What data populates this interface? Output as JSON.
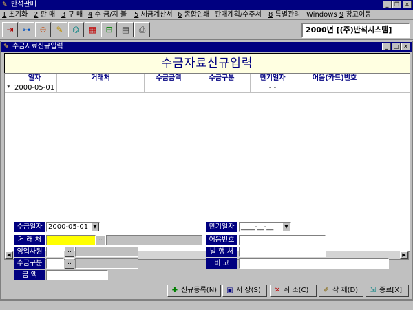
{
  "app": {
    "title": "반석판매",
    "window_buttons": [
      "_",
      "❐",
      "✕"
    ]
  },
  "menu": [
    {
      "key": "1",
      "label": "초기화"
    },
    {
      "key": "2",
      "label": "판 매"
    },
    {
      "key": "3",
      "label": "구 매"
    },
    {
      "key": "4",
      "label": "수 금/지 불"
    },
    {
      "key": "5",
      "label": "세금계산서"
    },
    {
      "key": "6",
      "label": "종합인쇄"
    },
    {
      "key": "",
      "label": "판매계획/수주서"
    },
    {
      "key": "8",
      "label": "특별관리"
    },
    {
      "key": "",
      "label": "Windows"
    },
    {
      "key": "9",
      "label": "창고이동"
    }
  ],
  "toolbar": {
    "icons": [
      "exit-door-icon",
      "tree-icon",
      "globe-icon",
      "pencil-icon",
      "network-icon",
      "grid-table-icon",
      "calendar-icon",
      "calculator-icon",
      "printer-icon"
    ],
    "company_label": "2000년 [(주)반석시스템]"
  },
  "child_window": {
    "title": "수금자료신규입력",
    "window_buttons": [
      "_",
      "□",
      "✕"
    ],
    "banner": "수금자료신규입력"
  },
  "grid": {
    "columns": [
      "일자",
      "거래처",
      "수금금액",
      "수금구분",
      "만기일자",
      "어음(카드)번호"
    ],
    "rows": [
      {
        "marker": "*",
        "date": "2000-05-01",
        "customer": "",
        "amount": "",
        "type": "",
        "due": "- -",
        "note_no": ""
      }
    ]
  },
  "form": {
    "date_label": "수금일자",
    "date_value": "2000-05-01",
    "customer_label": "거 래 처",
    "customer_value": "",
    "sales_label": "영업사원",
    "type_label": "수금구분",
    "amount_label": "금 액",
    "due_label": "만기일자",
    "due_value": "____-__-__",
    "bill_no_label": "어음번호",
    "issuer_label": "발 행 처",
    "remarks_label": "비 고",
    "dots": ".."
  },
  "actions": {
    "new": "신규등록(N)",
    "save": "저 장(S)",
    "cancel": "취 소(C)",
    "delete": "삭 제(D)",
    "close": "종료[X]"
  },
  "colors": {
    "title_bar": "#000080",
    "banner_bg": "#ffffe1",
    "highlight_input": "#ffff00"
  }
}
